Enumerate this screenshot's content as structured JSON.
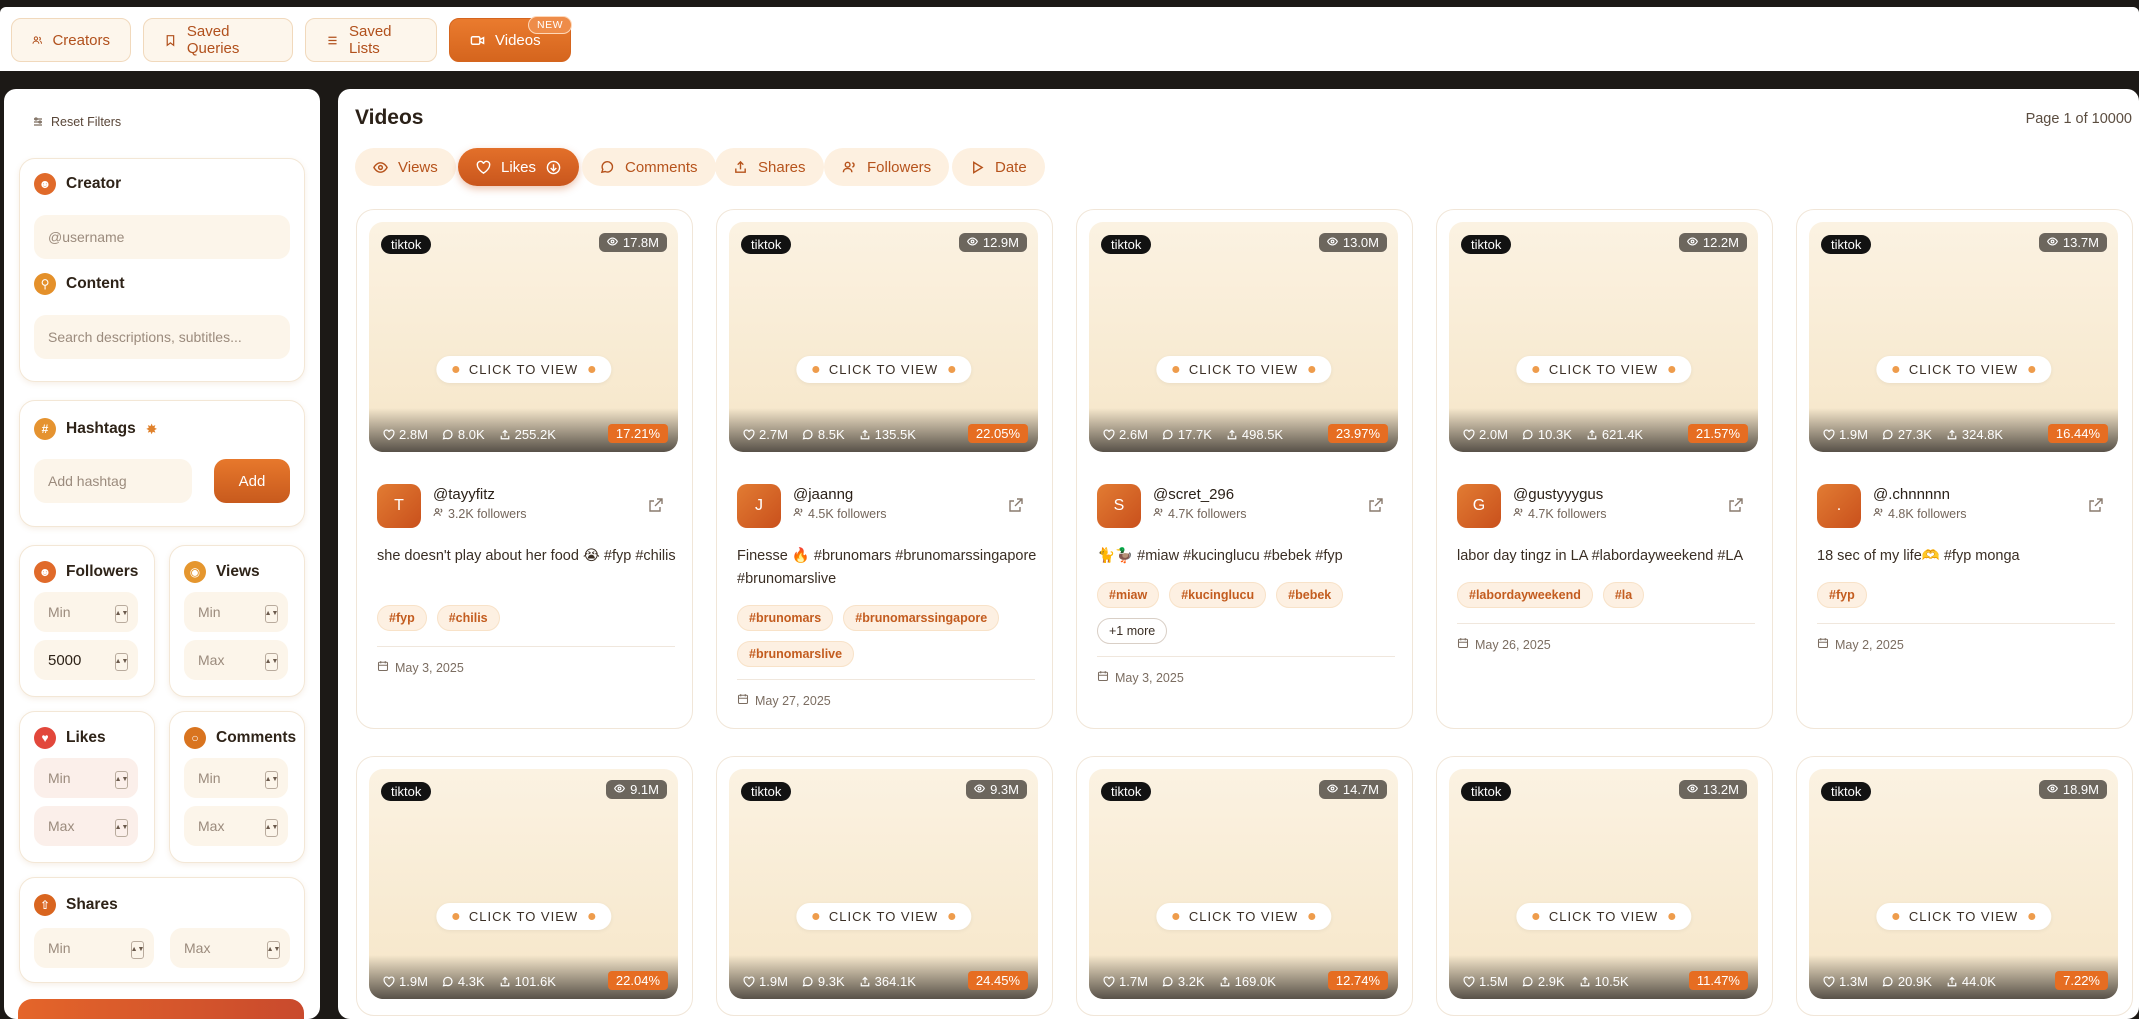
{
  "nav": {
    "creators": "Creators",
    "saved_queries": "Saved Queries",
    "saved_lists": "Saved Lists",
    "videos": "Videos",
    "new_badge": "NEW"
  },
  "sidebar": {
    "reset": "Reset Filters",
    "creator_label": "Creator",
    "creator_placeholder": "@username",
    "content_label": "Content",
    "content_placeholder": "Search descriptions, subtitles...",
    "hashtags_label": "Hashtags",
    "hashtag_placeholder": "Add hashtag",
    "add_label": "Add",
    "followers_label": "Followers",
    "followers_min": "Min",
    "followers_max_value": "5000",
    "views_label": "Views",
    "views_min": "Min",
    "views_max": "Max",
    "likes_label": "Likes",
    "likes_min": "Min",
    "likes_max": "Max",
    "comments_label": "Comments",
    "comments_min": "Min",
    "comments_max": "Max",
    "shares_label": "Shares",
    "shares_min": "Min",
    "shares_max": "Max"
  },
  "main": {
    "title": "Videos",
    "page_info": "Page 1 of 10000",
    "sort": [
      "Views",
      "Likes",
      "Comments",
      "Shares",
      "Followers",
      "Date"
    ],
    "active_sort": "Likes",
    "click_to_view": "CLICK TO VIEW"
  },
  "videos": [
    {
      "platform": "tiktok",
      "views": "17.8M",
      "likes": "2.8M",
      "comments": "8.0K",
      "shares": "255.2K",
      "er": "17.21%",
      "initial": "T",
      "username": "@tayyfitz",
      "followers": "3.2K followers",
      "desc": "she doesn't play about her food 😭 #fyp #chilis",
      "tags": [
        "#fyp",
        "#chilis"
      ],
      "date": "May 3, 2025"
    },
    {
      "platform": "tiktok",
      "views": "12.9M",
      "likes": "2.7M",
      "comments": "8.5K",
      "shares": "135.5K",
      "er": "22.05%",
      "initial": "J",
      "username": "@jaanng",
      "followers": "4.5K followers",
      "desc": "Finesse 🔥 #brunomars #brunomarssingapore #brunomarslive",
      "tags": [
        "#brunomars",
        "#brunomarssingapore",
        "#brunomarslive"
      ],
      "date": "May 27, 2025"
    },
    {
      "platform": "tiktok",
      "views": "13.0M",
      "likes": "2.6M",
      "comments": "17.7K",
      "shares": "498.5K",
      "er": "23.97%",
      "initial": "S",
      "username": "@scret_296",
      "followers": "4.7K followers",
      "desc": "🐈🦆 #miaw #kucinglucu #bebek #fyp",
      "tags": [
        "#miaw",
        "#kucinglucu",
        "#bebek"
      ],
      "more": "+1 more",
      "date": "May 3, 2025"
    },
    {
      "platform": "tiktok",
      "views": "12.2M",
      "likes": "2.0M",
      "comments": "10.3K",
      "shares": "621.4K",
      "er": "21.57%",
      "initial": "G",
      "username": "@gustyyygus",
      "followers": "4.7K followers",
      "desc": "labor day tingz in LA #labordayweekend #LA",
      "tags": [
        "#labordayweekend",
        "#la"
      ],
      "date": "May 26, 2025"
    },
    {
      "platform": "tiktok",
      "views": "13.7M",
      "likes": "1.9M",
      "comments": "27.3K",
      "shares": "324.8K",
      "er": "16.44%",
      "initial": ".",
      "username": "@.chnnnnn",
      "followers": "4.8K followers",
      "desc": "18 sec of my life🫶 #fyp monga",
      "tags": [
        "#fyp"
      ],
      "date": "May 2, 2025"
    }
  ],
  "videos_row2": [
    {
      "platform": "tiktok",
      "views": "9.1M",
      "likes": "1.9M",
      "comments": "4.3K",
      "shares": "101.6K",
      "er": "22.04%"
    },
    {
      "platform": "tiktok",
      "views": "9.3M",
      "likes": "1.9M",
      "comments": "9.3K",
      "shares": "364.1K",
      "er": "24.45%"
    },
    {
      "platform": "tiktok",
      "views": "14.7M",
      "likes": "1.7M",
      "comments": "3.2K",
      "shares": "169.0K",
      "er": "12.74%"
    },
    {
      "platform": "tiktok",
      "views": "13.2M",
      "likes": "1.5M",
      "comments": "2.9K",
      "shares": "10.5K",
      "er": "11.47%"
    },
    {
      "platform": "tiktok",
      "views": "18.9M",
      "likes": "1.3M",
      "comments": "20.9K",
      "shares": "44.0K",
      "er": "7.22%"
    }
  ],
  "colors": {
    "accent": "#e0702a",
    "accent_dark": "#c9561d",
    "tint": "#fdf0e0"
  },
  "icons": [
    "creators-icon",
    "bookmark-icon",
    "list-icon",
    "video-icon",
    "sliders-icon",
    "user-icon",
    "search-icon",
    "hash-icon",
    "eye-icon",
    "heart-icon",
    "comment-icon",
    "share-icon",
    "calendar-icon",
    "external-link-icon"
  ]
}
